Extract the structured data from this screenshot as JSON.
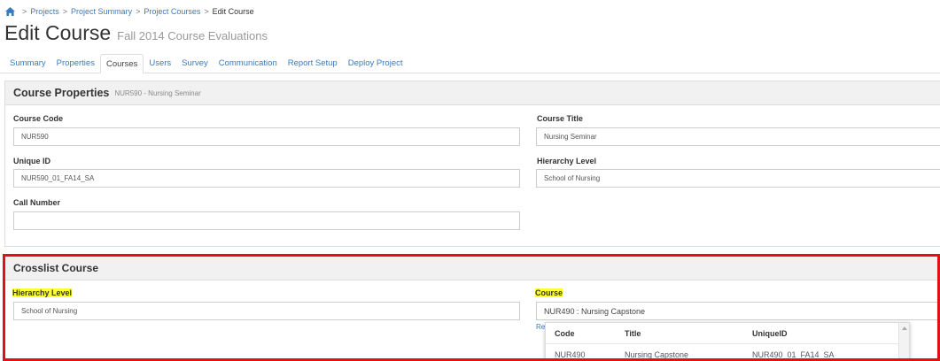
{
  "breadcrumb": {
    "items": [
      "Projects",
      "Project Summary",
      "Project Courses"
    ],
    "separator": ">",
    "current": "Edit Course"
  },
  "header": {
    "title": "Edit Course",
    "subtitle": "Fall 2014 Course Evaluations"
  },
  "tabs": [
    "Summary",
    "Properties",
    "Courses",
    "Users",
    "Survey",
    "Communication",
    "Report Setup",
    "Deploy Project"
  ],
  "active_tab": "Courses",
  "course_properties": {
    "title": "Course Properties",
    "subtitle": "NUR590 - Nursing Seminar",
    "course_code_label": "Course Code",
    "course_code_value": "NUR590",
    "course_title_label": "Course Title",
    "course_title_value": "Nursing Seminar",
    "unique_id_label": "Unique ID",
    "unique_id_value": "NUR590_01_FA14_SA",
    "hierarchy_label": "Hierarchy Level",
    "hierarchy_value": "School of Nursing",
    "call_number_label": "Call Number",
    "call_number_value": ""
  },
  "crosslist": {
    "title": "Crosslist Course",
    "hierarchy_label": "Hierarchy Level",
    "hierarchy_value": "School of Nursing",
    "course_label": "Course",
    "course_value": "NUR490 : Nursing Capstone",
    "link_partial": "Re",
    "dropdown": {
      "columns": [
        "Code",
        "Title",
        "UniqueID"
      ],
      "rows": [
        [
          "NUR490",
          "Nursing Capstone",
          "NUR490_01_FA14_SA"
        ]
      ]
    }
  },
  "colors": {
    "link": "#3a7bbf",
    "highlight": "#ffff33",
    "annotation": "#e31212"
  }
}
